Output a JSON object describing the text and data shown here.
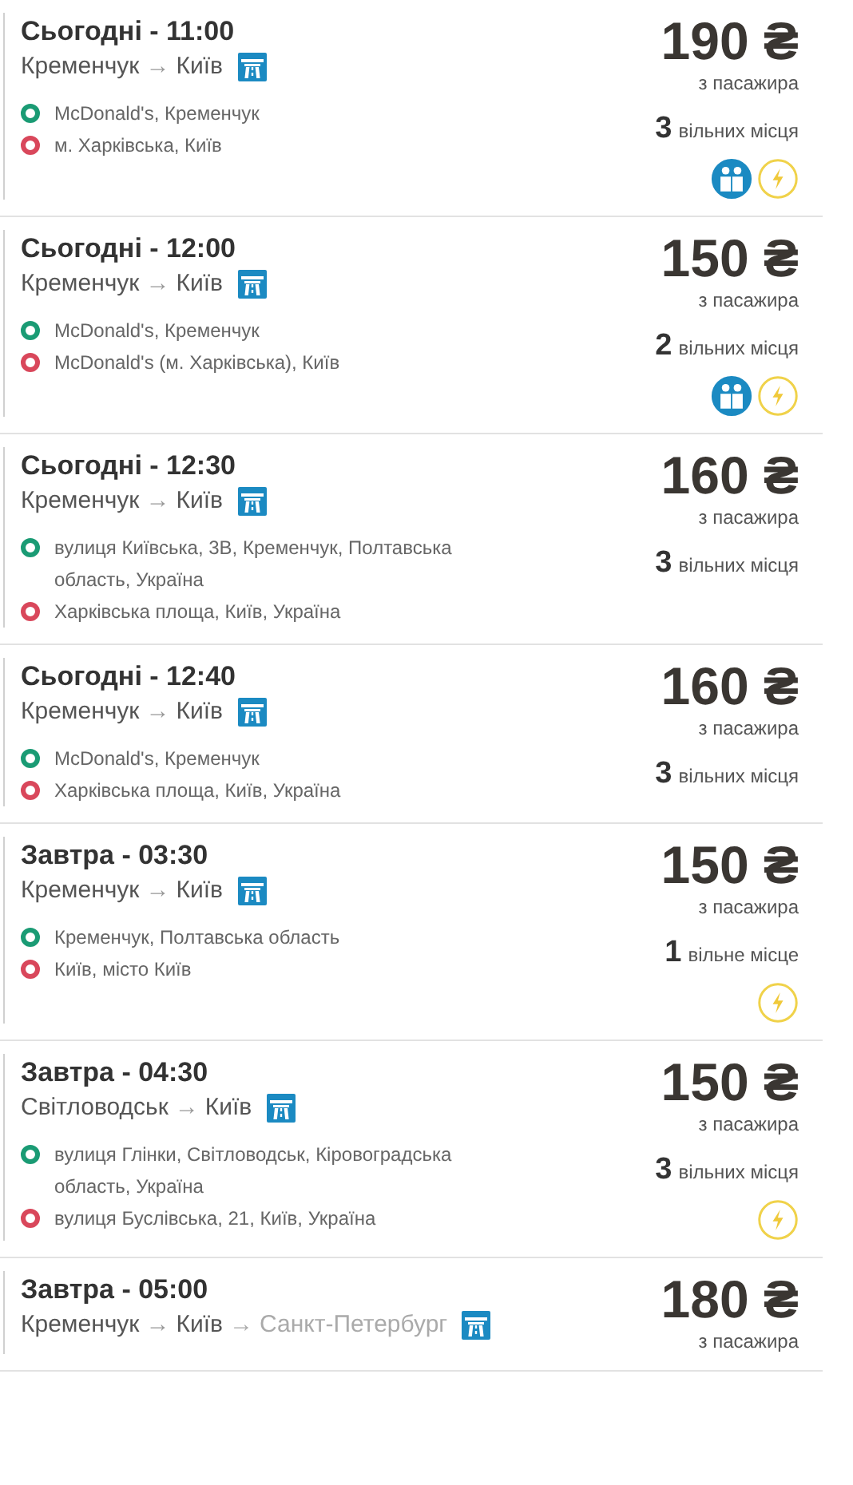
{
  "trips": [
    {
      "title": "Сьогодні - 11:00",
      "route": [
        {
          "kind": "city",
          "text": "Кременчук",
          "dimmed": false
        },
        {
          "kind": "arrow",
          "text": "→",
          "dimmed": false
        },
        {
          "kind": "city",
          "text": "Київ",
          "dimmed": false
        }
      ],
      "stops": [
        {
          "kind": "departure",
          "text": "McDonald's, Кременчук"
        },
        {
          "kind": "arrival",
          "text": "м. Харківська, Київ"
        }
      ],
      "price": "190 ₴",
      "price_note": "з пасажира",
      "seats_count": "3",
      "seats_label": "вільних місця",
      "amenities": [
        {
          "kind": "passengers"
        },
        {
          "kind": "charging"
        }
      ]
    },
    {
      "title": "Сьогодні - 12:00",
      "route": [
        {
          "kind": "city",
          "text": "Кременчук",
          "dimmed": false
        },
        {
          "kind": "arrow",
          "text": "→",
          "dimmed": false
        },
        {
          "kind": "city",
          "text": "Київ",
          "dimmed": false
        }
      ],
      "stops": [
        {
          "kind": "departure",
          "text": "McDonald's, Кременчук"
        },
        {
          "kind": "arrival",
          "text": "McDonald's (м. Харківська), Київ"
        }
      ],
      "price": "150 ₴",
      "price_note": "з пасажира",
      "seats_count": "2",
      "seats_label": "вільних місця",
      "amenities": [
        {
          "kind": "passengers"
        },
        {
          "kind": "charging"
        }
      ]
    },
    {
      "title": "Сьогодні - 12:30",
      "route": [
        {
          "kind": "city",
          "text": "Кременчук",
          "dimmed": false
        },
        {
          "kind": "arrow",
          "text": "→",
          "dimmed": false
        },
        {
          "kind": "city",
          "text": "Київ",
          "dimmed": false
        }
      ],
      "stops": [
        {
          "kind": "departure",
          "text": "вулиця Київська, 3В, Кременчук, Полтавська область, Україна"
        },
        {
          "kind": "arrival",
          "text": "Харківська площа, Київ, Україна"
        }
      ],
      "price": "160 ₴",
      "price_note": "з пасажира",
      "seats_count": "3",
      "seats_label": "вільних місця"
    },
    {
      "title": "Сьогодні - 12:40",
      "route": [
        {
          "kind": "city",
          "text": "Кременчук",
          "dimmed": false
        },
        {
          "kind": "arrow",
          "text": "→",
          "dimmed": false
        },
        {
          "kind": "city",
          "text": "Київ",
          "dimmed": false
        }
      ],
      "stops": [
        {
          "kind": "departure",
          "text": "McDonald's, Кременчук"
        },
        {
          "kind": "arrival",
          "text": "Харківська площа, Київ, Україна"
        }
      ],
      "price": "160 ₴",
      "price_note": "з пасажира",
      "seats_count": "3",
      "seats_label": "вільних місця"
    },
    {
      "title": "Завтра - 03:30",
      "route": [
        {
          "kind": "city",
          "text": "Кременчук",
          "dimmed": false
        },
        {
          "kind": "arrow",
          "text": "→",
          "dimmed": false
        },
        {
          "kind": "city",
          "text": "Київ",
          "dimmed": false
        }
      ],
      "stops": [
        {
          "kind": "departure",
          "text": "Кременчук, Полтавська область"
        },
        {
          "kind": "arrival",
          "text": "Київ, місто Київ"
        }
      ],
      "price": "150 ₴",
      "price_note": "з пасажира",
      "seats_count": "1",
      "seats_label": "вільне місце",
      "amenities": [
        {
          "kind": "charging"
        }
      ]
    },
    {
      "title": "Завтра - 04:30",
      "route": [
        {
          "kind": "city",
          "text": "Світловодськ",
          "dimmed": false
        },
        {
          "kind": "arrow",
          "text": "→",
          "dimmed": false
        },
        {
          "kind": "city",
          "text": "Київ",
          "dimmed": false
        }
      ],
      "stops": [
        {
          "kind": "departure",
          "text": "вулиця Глінки, Світловодськ, Кіровоградська область, Україна"
        },
        {
          "kind": "arrival",
          "text": "вулиця Буслівська, 21, Київ, Україна"
        }
      ],
      "price": "150 ₴",
      "price_note": "з пасажира",
      "seats_count": "3",
      "seats_label": "вільних місця",
      "amenities": [
        {
          "kind": "charging"
        }
      ]
    },
    {
      "title": "Завтра - 05:00",
      "route": [
        {
          "kind": "city",
          "text": "Кременчук",
          "dimmed": false
        },
        {
          "kind": "arrow",
          "text": "→",
          "dimmed": false
        },
        {
          "kind": "city",
          "text": "Київ",
          "dimmed": false
        },
        {
          "kind": "arrow",
          "text": "→",
          "dimmed": true
        },
        {
          "kind": "city",
          "text": "Санкт-Петербург",
          "dimmed": true
        }
      ],
      "price": "180 ₴",
      "price_note": "з пасажира"
    }
  ]
}
